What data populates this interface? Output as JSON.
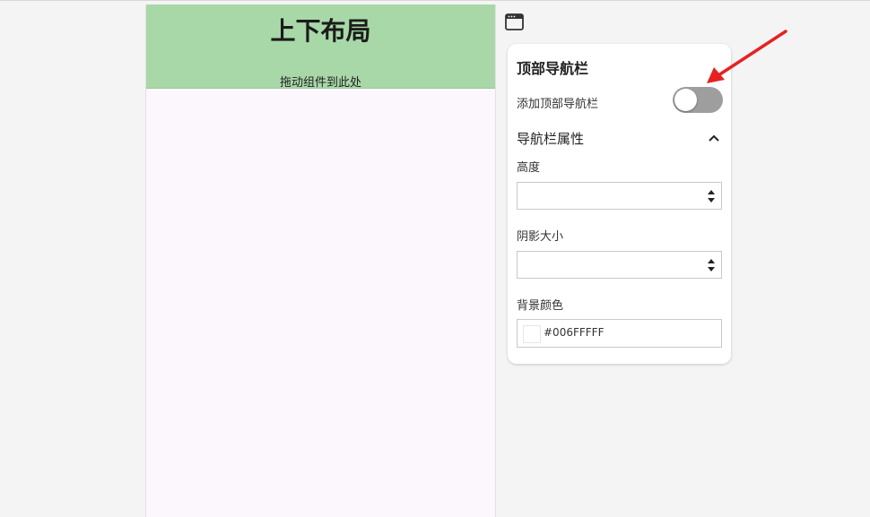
{
  "preview": {
    "title": "上下布局",
    "drop_hint": "拖动组件到此处",
    "header_color": "#a8d8a8",
    "canvas_color": "#fcf7fc"
  },
  "icons": {
    "window": "window-icon",
    "chevron": "chevron-up-icon",
    "spinner": "spinner-icon"
  },
  "panel": {
    "title": "顶部导航栏",
    "toggle_label": "添加顶部导航栏",
    "toggle_on": false,
    "section_title": "导航栏属性",
    "section_expanded": true,
    "fields": {
      "height_label": "高度",
      "height_value": "",
      "shadow_label": "阴影大小",
      "shadow_value": "",
      "bg_color_label": "背景颜色",
      "bg_color_value": "#006FFFFF"
    }
  },
  "annotation": {
    "arrow_color": "#e52222"
  }
}
